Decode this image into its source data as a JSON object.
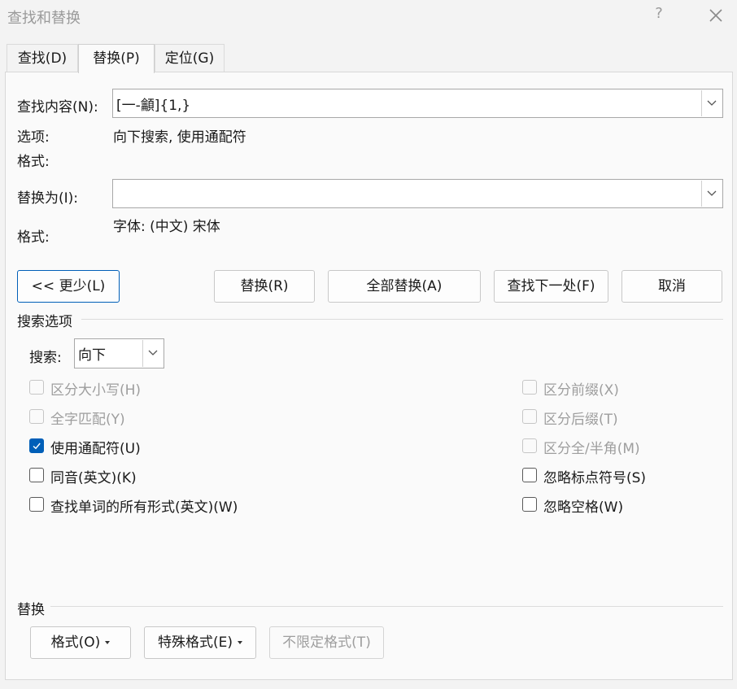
{
  "window": {
    "title": "查找和替换",
    "help": "?"
  },
  "tabs": [
    {
      "label": "查找(D)",
      "active": false
    },
    {
      "label": "替换(P)",
      "active": true
    },
    {
      "label": "定位(G)",
      "active": false
    }
  ],
  "find": {
    "label": "查找内容(N):",
    "value": "[一-龥]{1,}"
  },
  "options": {
    "label": "选项:",
    "value": "向下搜索, 使用通配符"
  },
  "find_format": {
    "label": "格式:"
  },
  "replace": {
    "label": "替换为(I):",
    "value": ""
  },
  "replace_format": {
    "label": "格式:",
    "value": "字体: (中文) 宋体"
  },
  "buttons": {
    "less": "<< 更少(L)",
    "replace": "替换(R)",
    "replace_all": "全部替换(A)",
    "find_next": "查找下一处(F)",
    "cancel": "取消"
  },
  "search_options": {
    "title": "搜索选项",
    "search_label": "搜索:",
    "search_direction": "向下"
  },
  "checkboxes_left": [
    {
      "label": "区分大小写(H)",
      "checked": false,
      "enabled": false
    },
    {
      "label": "全字匹配(Y)",
      "checked": false,
      "enabled": false
    },
    {
      "label": "使用通配符(U)",
      "checked": true,
      "enabled": true
    },
    {
      "label": "同音(英文)(K)",
      "checked": false,
      "enabled": true
    },
    {
      "label": "查找单词的所有形式(英文)(W)",
      "checked": false,
      "enabled": true
    }
  ],
  "checkboxes_right": [
    {
      "label": "区分前缀(X)",
      "checked": false,
      "enabled": false
    },
    {
      "label": "区分后缀(T)",
      "checked": false,
      "enabled": false
    },
    {
      "label": "区分全/半角(M)",
      "checked": false,
      "enabled": false
    },
    {
      "label": "忽略标点符号(S)",
      "checked": false,
      "enabled": true
    },
    {
      "label": "忽略空格(W)",
      "checked": false,
      "enabled": true
    }
  ],
  "replace_section": {
    "title": "替换",
    "format_button": "格式(O)",
    "special_button": "特殊格式(E)",
    "no_format_button": "不限定格式(T)"
  },
  "colors": {
    "accent": "#005fb8",
    "disabled_text": "#9e9e9e",
    "panel": "#fafafa",
    "window": "#f3f3f3"
  },
  "icons": {
    "close": "close-icon",
    "dropdown": "chevron-down-icon",
    "check": "check-icon",
    "menu_caret": "caret-down-icon"
  }
}
